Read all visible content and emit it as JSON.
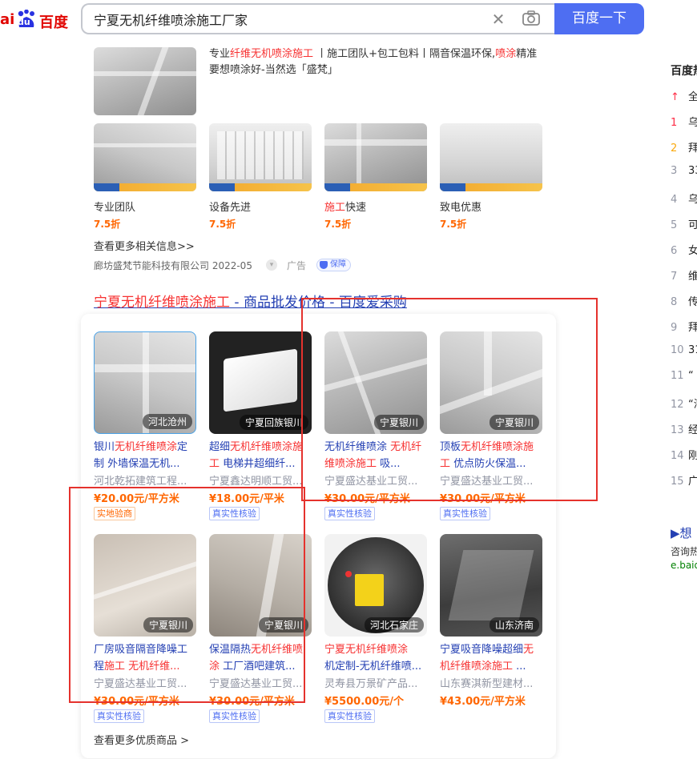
{
  "header": {
    "logo_text_a": "ai",
    "logo_text_du": "du",
    "logo_text_cn": "百度",
    "search_value": "宁夏无机纤维喷涂施工厂家",
    "search_button": "百度一下"
  },
  "ad": {
    "desc_line1_a": "专业",
    "desc_line1_b": "纤维无机喷涂施工",
    "desc_line1_c": " 丨施工团队+包工包料丨隔音保温环保,",
    "desc_line1_d": "喷涂",
    "desc_line1_e": "精准",
    "desc_line2": "要想喷涂好-当然选「盛梵」",
    "items": [
      {
        "caption": "专业团队",
        "discount": "7.5折"
      },
      {
        "caption": "设备先进",
        "discount": "7.5折"
      },
      {
        "caption_hl": "施工",
        "caption_rest": "快速",
        "discount": "7.5折"
      },
      {
        "caption": "致电优惠",
        "discount": "7.5折"
      }
    ],
    "more_link": "查看更多相关信息>>",
    "source": "廊坊盛梵节能科技有限公司 2022-05",
    "ad_label": "广告",
    "guard_label": "保障"
  },
  "result": {
    "title_hl": "宁夏无机纤维喷涂施工",
    "title_rest": " - 商品批发价格 - 百度爱采购"
  },
  "products": [
    {
      "loc": "河北沧州",
      "t1": "银川",
      "t1h": "无机纤维喷涂",
      "t2": "定制 外墙保温无机...",
      "seller": "河北乾拓建筑工程...",
      "price": "¥20.00元/平方米",
      "badge": "实地验商",
      "badge_type": "orange"
    },
    {
      "loc": "宁夏回族银川",
      "t1": "超细",
      "t1h": "无机纤维喷涂施",
      "t2h": "工",
      "t2": " 电梯井超细纤...",
      "seller": "宁夏鑫达明顺工贸...",
      "price": "¥18.00元/平米",
      "badge": "真实性核验",
      "badge_type": "blue"
    },
    {
      "loc": "宁夏银川",
      "t1": "无机纤维喷涂 ",
      "t1h": "无机纤",
      "t2h": "维喷涂施工",
      "t2": " 吸...",
      "seller": "宁夏盛达基业工贸...",
      "price": "¥30.00元/平方米",
      "badge": "真实性核验",
      "badge_type": "blue"
    },
    {
      "loc": "宁夏银川",
      "t1": "顶板",
      "t1h": "无机纤维喷涂施",
      "t2h": "工",
      "t2": " 优点防火保温...",
      "seller": "宁夏盛达基业工贸...",
      "price": "¥30.00元/平方米",
      "badge": "真实性核验",
      "badge_type": "blue"
    },
    {
      "loc": "宁夏银川",
      "t1": "厂房吸音隔音降噪工",
      "t1h": "",
      "t2": "程",
      "t2h": "施工 无机纤维...",
      "seller": "宁夏盛达基业工贸...",
      "price": "¥30.00元/平方米",
      "badge": "真实性核验",
      "badge_type": "blue"
    },
    {
      "loc": "宁夏银川",
      "t1": "保温隔热",
      "t1h": "无机纤维喷",
      "t2h": "涂",
      "t2": " 工厂酒吧建筑...",
      "seller": "宁夏盛达基业工贸...",
      "price": "¥30.00元/平方米",
      "badge": "真实性核验",
      "badge_type": "blue"
    },
    {
      "loc": "河北石家庄",
      "t1": "",
      "t1h": "宁夏无机纤维喷涂",
      "t2": "机定制-无机纤维喷...",
      "seller": "灵寿县万景矿产品...",
      "price": "¥5500.00元/个",
      "badge": "真实性核验",
      "badge_type": "blue"
    },
    {
      "loc": "山东济南",
      "t1": "宁夏吸音降噪超细",
      "t1h": "无",
      "t2h": "机纤维喷涂施工",
      "t2": " ...",
      "seller": "山东赛淇新型建材...",
      "price": "¥43.00元/平方米",
      "badge": "",
      "badge_type": "none"
    }
  ],
  "more_products": "查看更多优质商品 >",
  "right": {
    "hot_title": "百度热",
    "rows": [
      {
        "num": "↑",
        "text": "全"
      },
      {
        "num": "1",
        "text": "乌"
      },
      {
        "num": "2",
        "text": "拜"
      },
      {
        "num": "3",
        "text": "33"
      },
      {
        "num": "4",
        "text": "乌"
      },
      {
        "num": "5",
        "text": "可"
      },
      {
        "num": "6",
        "text": "女"
      },
      {
        "num": "7",
        "text": "维"
      },
      {
        "num": "8",
        "text": "传"
      },
      {
        "num": "9",
        "text": "拜"
      },
      {
        "num": "10",
        "text": "31"
      },
      {
        "num": "11",
        "text": "“"
      },
      {
        "num": "12",
        "text": "“海"
      },
      {
        "num": "13",
        "text": "经"
      },
      {
        "num": "14",
        "text": "刚"
      },
      {
        "num": "15",
        "text": "广"
      }
    ],
    "more_title": "▶想",
    "more_desc": "咨询热",
    "more_url": "e.baid"
  },
  "colors": {
    "brand_blue": "#4e6ef2",
    "highlight_red": "#f73131",
    "price_orange": "#ff6600",
    "annotation_red": "#e5322d"
  }
}
